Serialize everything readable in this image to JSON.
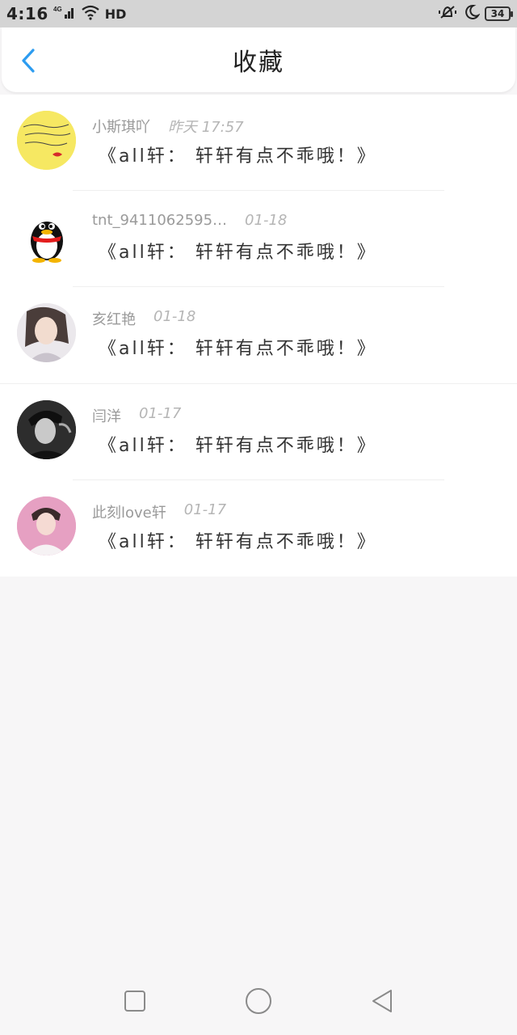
{
  "status_bar": {
    "time": "4:16",
    "signal_label": "4G",
    "hd_label": "HD",
    "battery": "34",
    "icons": [
      "signal-icon",
      "wifi-icon",
      "hd-icon",
      "vibrate-icon",
      "moon-icon",
      "battery-icon"
    ]
  },
  "header": {
    "title": "收藏",
    "back_icon": "chevron-left-icon",
    "accent_color": "#2d9cf0"
  },
  "items": [
    {
      "name": "小斯琪吖",
      "time": "昨天 17:57",
      "content": "《all轩： 轩轩有点不乖哦！》"
    },
    {
      "name": "tnt_9411062595…",
      "time": "01-18",
      "content": "《all轩： 轩轩有点不乖哦！》"
    },
    {
      "name": "亥红艳",
      "time": "01-18",
      "content": "《all轩： 轩轩有点不乖哦！》"
    },
    {
      "name": "闫洋",
      "time": "01-17",
      "content": "《all轩： 轩轩有点不乖哦！》"
    },
    {
      "name": "此刻love轩",
      "time": "01-17",
      "content": "《all轩： 轩轩有点不乖哦！》"
    }
  ],
  "nav": {
    "icons": [
      "square-icon",
      "circle-icon",
      "triangle-back-icon"
    ]
  }
}
